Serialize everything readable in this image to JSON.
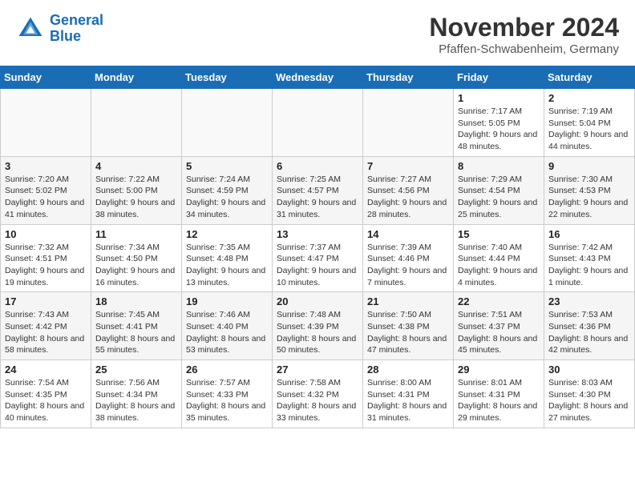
{
  "header": {
    "logo_line1": "General",
    "logo_line2": "Blue",
    "month_year": "November 2024",
    "location": "Pfaffen-Schwabenheim, Germany"
  },
  "weekdays": [
    "Sunday",
    "Monday",
    "Tuesday",
    "Wednesday",
    "Thursday",
    "Friday",
    "Saturday"
  ],
  "weeks": [
    [
      {
        "day": "",
        "info": ""
      },
      {
        "day": "",
        "info": ""
      },
      {
        "day": "",
        "info": ""
      },
      {
        "day": "",
        "info": ""
      },
      {
        "day": "",
        "info": ""
      },
      {
        "day": "1",
        "info": "Sunrise: 7:17 AM\nSunset: 5:05 PM\nDaylight: 9 hours and 48 minutes."
      },
      {
        "day": "2",
        "info": "Sunrise: 7:19 AM\nSunset: 5:04 PM\nDaylight: 9 hours and 44 minutes."
      }
    ],
    [
      {
        "day": "3",
        "info": "Sunrise: 7:20 AM\nSunset: 5:02 PM\nDaylight: 9 hours and 41 minutes."
      },
      {
        "day": "4",
        "info": "Sunrise: 7:22 AM\nSunset: 5:00 PM\nDaylight: 9 hours and 38 minutes."
      },
      {
        "day": "5",
        "info": "Sunrise: 7:24 AM\nSunset: 4:59 PM\nDaylight: 9 hours and 34 minutes."
      },
      {
        "day": "6",
        "info": "Sunrise: 7:25 AM\nSunset: 4:57 PM\nDaylight: 9 hours and 31 minutes."
      },
      {
        "day": "7",
        "info": "Sunrise: 7:27 AM\nSunset: 4:56 PM\nDaylight: 9 hours and 28 minutes."
      },
      {
        "day": "8",
        "info": "Sunrise: 7:29 AM\nSunset: 4:54 PM\nDaylight: 9 hours and 25 minutes."
      },
      {
        "day": "9",
        "info": "Sunrise: 7:30 AM\nSunset: 4:53 PM\nDaylight: 9 hours and 22 minutes."
      }
    ],
    [
      {
        "day": "10",
        "info": "Sunrise: 7:32 AM\nSunset: 4:51 PM\nDaylight: 9 hours and 19 minutes."
      },
      {
        "day": "11",
        "info": "Sunrise: 7:34 AM\nSunset: 4:50 PM\nDaylight: 9 hours and 16 minutes."
      },
      {
        "day": "12",
        "info": "Sunrise: 7:35 AM\nSunset: 4:48 PM\nDaylight: 9 hours and 13 minutes."
      },
      {
        "day": "13",
        "info": "Sunrise: 7:37 AM\nSunset: 4:47 PM\nDaylight: 9 hours and 10 minutes."
      },
      {
        "day": "14",
        "info": "Sunrise: 7:39 AM\nSunset: 4:46 PM\nDaylight: 9 hours and 7 minutes."
      },
      {
        "day": "15",
        "info": "Sunrise: 7:40 AM\nSunset: 4:44 PM\nDaylight: 9 hours and 4 minutes."
      },
      {
        "day": "16",
        "info": "Sunrise: 7:42 AM\nSunset: 4:43 PM\nDaylight: 9 hours and 1 minute."
      }
    ],
    [
      {
        "day": "17",
        "info": "Sunrise: 7:43 AM\nSunset: 4:42 PM\nDaylight: 8 hours and 58 minutes."
      },
      {
        "day": "18",
        "info": "Sunrise: 7:45 AM\nSunset: 4:41 PM\nDaylight: 8 hours and 55 minutes."
      },
      {
        "day": "19",
        "info": "Sunrise: 7:46 AM\nSunset: 4:40 PM\nDaylight: 8 hours and 53 minutes."
      },
      {
        "day": "20",
        "info": "Sunrise: 7:48 AM\nSunset: 4:39 PM\nDaylight: 8 hours and 50 minutes."
      },
      {
        "day": "21",
        "info": "Sunrise: 7:50 AM\nSunset: 4:38 PM\nDaylight: 8 hours and 47 minutes."
      },
      {
        "day": "22",
        "info": "Sunrise: 7:51 AM\nSunset: 4:37 PM\nDaylight: 8 hours and 45 minutes."
      },
      {
        "day": "23",
        "info": "Sunrise: 7:53 AM\nSunset: 4:36 PM\nDaylight: 8 hours and 42 minutes."
      }
    ],
    [
      {
        "day": "24",
        "info": "Sunrise: 7:54 AM\nSunset: 4:35 PM\nDaylight: 8 hours and 40 minutes."
      },
      {
        "day": "25",
        "info": "Sunrise: 7:56 AM\nSunset: 4:34 PM\nDaylight: 8 hours and 38 minutes."
      },
      {
        "day": "26",
        "info": "Sunrise: 7:57 AM\nSunset: 4:33 PM\nDaylight: 8 hours and 35 minutes."
      },
      {
        "day": "27",
        "info": "Sunrise: 7:58 AM\nSunset: 4:32 PM\nDaylight: 8 hours and 33 minutes."
      },
      {
        "day": "28",
        "info": "Sunrise: 8:00 AM\nSunset: 4:31 PM\nDaylight: 8 hours and 31 minutes."
      },
      {
        "day": "29",
        "info": "Sunrise: 8:01 AM\nSunset: 4:31 PM\nDaylight: 8 hours and 29 minutes."
      },
      {
        "day": "30",
        "info": "Sunrise: 8:03 AM\nSunset: 4:30 PM\nDaylight: 8 hours and 27 minutes."
      }
    ]
  ]
}
